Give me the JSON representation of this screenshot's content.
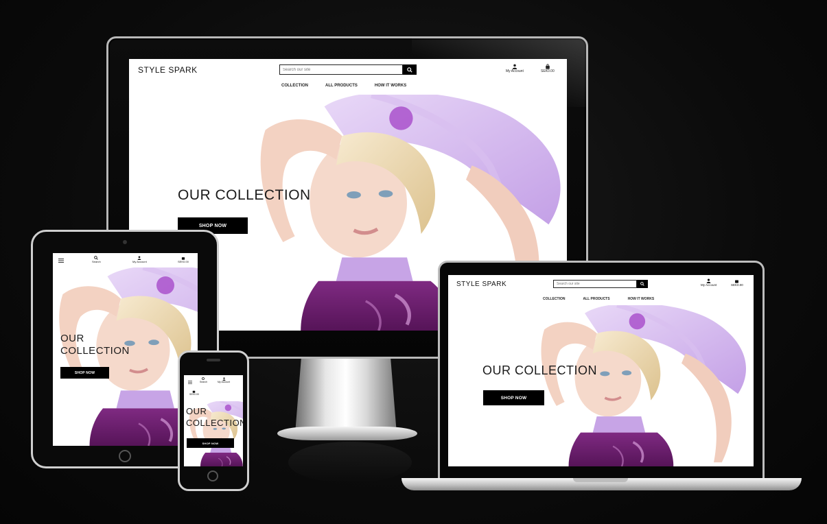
{
  "site": {
    "brand": "STYLE SPARK",
    "search_placeholder": "Search our site",
    "nav": [
      "COLLECTION",
      "ALL PRODUCTS",
      "HOW IT WORKS"
    ],
    "account_label": "My Account",
    "cart_total": "SEK0.00",
    "search_label": "Search",
    "hero_title": "OUR COLLECTION",
    "hero_title_line1": "OUR",
    "hero_title_line2": "COLLECTION",
    "cta_label": "SHOP NOW"
  },
  "colors": {
    "background": "#0b0b0b",
    "button": "#000000",
    "dress_purple": "#6b1d6e",
    "lilac": "#c9a6e8",
    "skin": "#f3d2c2",
    "hair": "#f1e1b9"
  },
  "icons": [
    "search-icon",
    "person-icon",
    "bag-icon",
    "hamburger-icon"
  ]
}
